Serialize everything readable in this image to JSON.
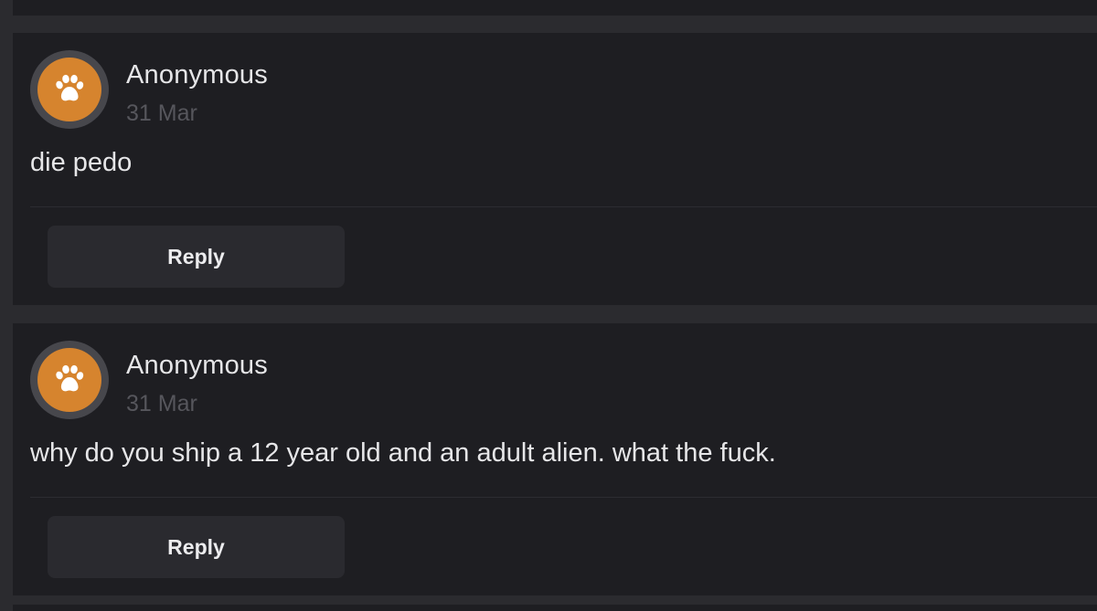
{
  "comments": [
    {
      "author": "Anonymous",
      "date": "31 Mar",
      "text": "die pedo",
      "reply_label": "Reply",
      "avatar_icon": "paw-icon"
    },
    {
      "author": "Anonymous",
      "date": "31 Mar",
      "text": "why do you ship a 12 year old and an adult alien. what the fuck.",
      "reply_label": "Reply",
      "avatar_icon": "paw-icon"
    }
  ],
  "colors": {
    "page_background": "#2b2b2f",
    "card_background": "#1e1e22",
    "avatar_ring": "#47474c",
    "avatar_fill": "#d6842e",
    "button_background": "#2a2a2f",
    "date_text": "#56565c"
  }
}
